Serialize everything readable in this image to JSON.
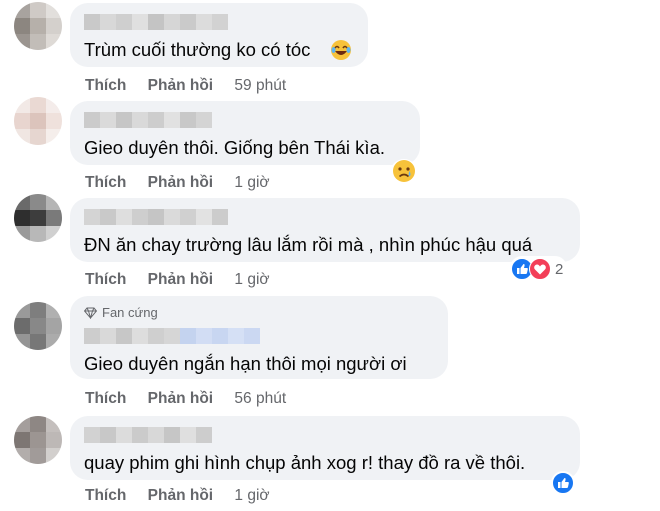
{
  "comments": [
    {
      "text": "Trùm cuối thường ko có tóc",
      "actions": {
        "like": "Thích",
        "reply": "Phản hồi"
      },
      "time": "59 phút"
    },
    {
      "text": "Gieo duyên thôi. Giống bên Thái kìa.",
      "actions": {
        "like": "Thích",
        "reply": "Phản hồi"
      },
      "time": "1 giờ",
      "reaction": "sad-emoji-icon"
    },
    {
      "text": "ĐN ăn chay trường lâu lắm rồi mà , nhìn phúc hậu quá",
      "actions": {
        "like": "Thích",
        "reply": "Phản hồi"
      },
      "time": "1 giờ",
      "reaction_count": "2",
      "reactions": [
        "like-icon",
        "love-icon"
      ]
    },
    {
      "badge": "Fan cứng",
      "text": "Gieo duyên ngắn hạn thôi mọi người ơi",
      "actions": {
        "like": "Thích",
        "reply": "Phản hồi"
      },
      "time": "56 phút"
    },
    {
      "text": "quay phim ghi hình chụp ảnh xog r! thay đồ ra về thôi.",
      "actions": {
        "like": "Thích",
        "reply": "Phản hồi"
      },
      "time": "1 giờ",
      "reactions": [
        "like-icon"
      ]
    }
  ],
  "colors": {
    "bubble": "#f0f2f5",
    "meta": "#65676b",
    "text": "#050505",
    "like_blue": "#1877f2",
    "love_red": "#f33e58"
  }
}
